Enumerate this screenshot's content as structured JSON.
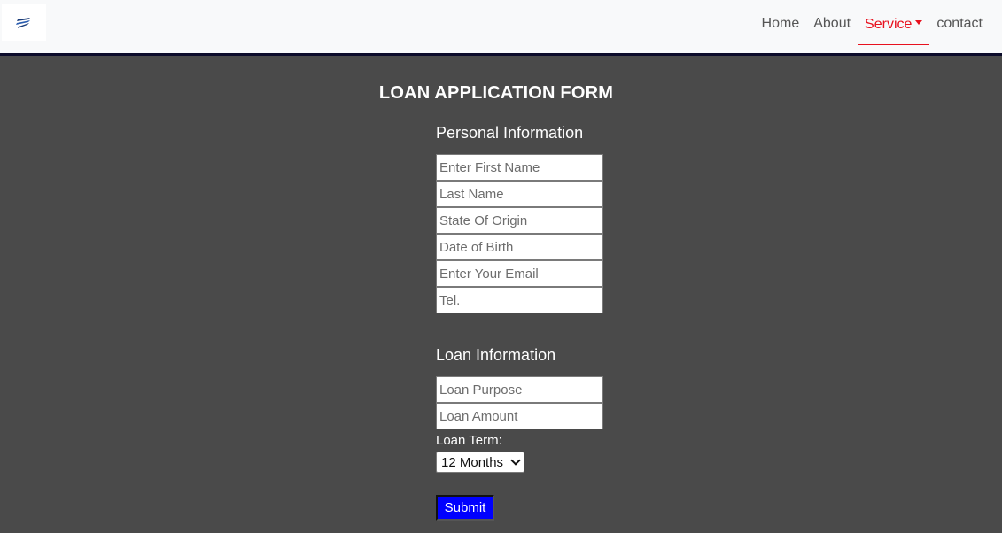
{
  "nav": {
    "links": [
      "Home",
      "About",
      "Service",
      "contact"
    ],
    "active": "Service",
    "accent_color": "#e8111e"
  },
  "form": {
    "title": "LOAN APPLICATION FORM",
    "personal": {
      "heading": "Personal Information",
      "fields": [
        {
          "placeholder": "Enter First Name",
          "value": ""
        },
        {
          "placeholder": "Last Name",
          "value": ""
        },
        {
          "placeholder": "State Of Origin",
          "value": ""
        },
        {
          "placeholder": "Date of Birth",
          "value": ""
        },
        {
          "placeholder": "Enter Your Email",
          "value": ""
        },
        {
          "placeholder": "Tel.",
          "value": ""
        }
      ]
    },
    "loan": {
      "heading": "Loan Information",
      "fields": [
        {
          "placeholder": "Loan Purpose",
          "value": ""
        },
        {
          "placeholder": "Loan Amount",
          "value": ""
        }
      ],
      "term_label": "Loan Term:",
      "term_selected": "12 Months"
    },
    "submit_label": "Submit",
    "submit_color": "#0000ff",
    "background_color": "#4a4a4a"
  }
}
